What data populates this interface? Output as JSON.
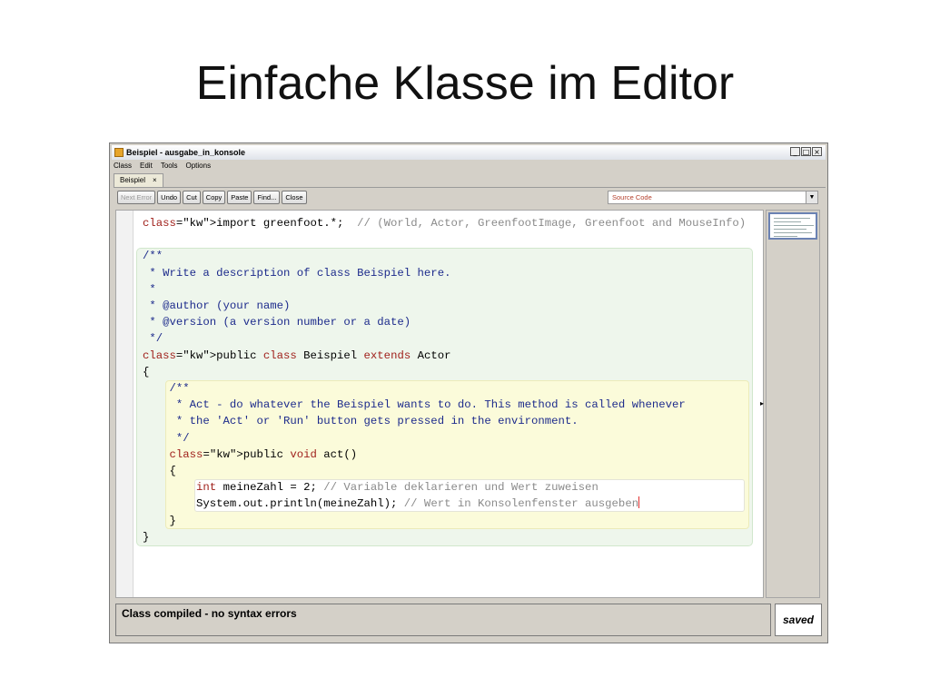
{
  "slide": {
    "title": "Einfache Klasse im Editor"
  },
  "window": {
    "title": "Beispiel - ausgabe_in_konsole",
    "controls": {
      "minimize": "_",
      "maximize": "□",
      "close": "×"
    }
  },
  "menu": [
    "Class",
    "Edit",
    "Tools",
    "Options"
  ],
  "tab": {
    "label": "Beispiel",
    "close": "×"
  },
  "toolbar": {
    "buttons": [
      "Next Error",
      "Undo",
      "Cut",
      "Copy",
      "Paste",
      "Find...",
      "Close"
    ],
    "view_select": "Source Code"
  },
  "code_lines": [
    "import greenfoot.*;  // (World, Actor, GreenfootImage, Greenfoot and MouseInfo)",
    "",
    "/**",
    " * Write a description of class Beispiel here.",
    " *",
    " * @author (your name)",
    " * @version (a version number or a date)",
    " */",
    "public class Beispiel extends Actor",
    "{",
    "    /**",
    "     * Act - do whatever the Beispiel wants to do. This method is called whenever",
    "     * the 'Act' or 'Run' button gets pressed in the environment.",
    "     */",
    "    public void act()",
    "    {",
    "        int meineZahl = 2; // Variable deklarieren und Wert zuweisen",
    "        System.out.println(meineZahl); // Wert in Konsolenfenster ausgeben",
    "    }",
    "}"
  ],
  "status": {
    "message": "Class compiled - no syntax errors",
    "saved": "saved"
  },
  "colors": {
    "keyword": "#a0211c",
    "comment": "#8a8a8a",
    "javadoc": "#1d2b8c",
    "class_scope": "#eef6ec",
    "method_scope": "#fbfbda"
  }
}
